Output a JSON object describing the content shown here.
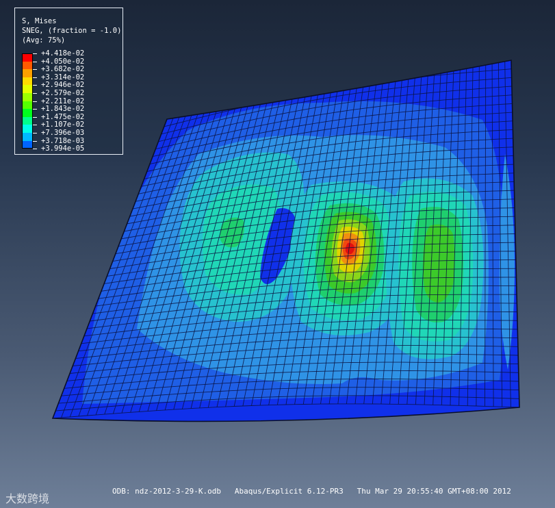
{
  "legend": {
    "title": "S, Mises",
    "subtitle": "SNEG, (fraction = -1.0)",
    "avg": "(Avg: 75%)",
    "values": [
      "+4.418e-02",
      "+4.050e-02",
      "+3.682e-02",
      "+3.314e-02",
      "+2.946e-02",
      "+2.579e-02",
      "+2.211e-02",
      "+1.843e-02",
      "+1.475e-02",
      "+1.107e-02",
      "+7.396e-03",
      "+3.718e-03",
      "+3.994e-05"
    ],
    "colors": [
      "#ff0000",
      "#ff5a00",
      "#ffa000",
      "#ffdb00",
      "#e4ff00",
      "#9cff00",
      "#55ff00",
      "#00ff1e",
      "#00ff8c",
      "#00ffe8",
      "#00b9ff",
      "#0064ff",
      "#0000ff"
    ]
  },
  "footer": {
    "odb": "ODB: ndz-2012-3-29-K.odb",
    "solver": "Abaqus/Explicit 6.12-PR3",
    "timestamp": "Thu Mar 29 20:55:40 GMT+08:00 2012"
  },
  "watermark": "大数跨境",
  "contour_palette": [
    "#1030ea",
    "#1f5fe6",
    "#2f93e6",
    "#27c2cf",
    "#20d7b7",
    "#1fcf6e",
    "#3cca2a",
    "#8bd51a",
    "#e1d400",
    "#f08f10",
    "#f04810",
    "#e01010"
  ]
}
